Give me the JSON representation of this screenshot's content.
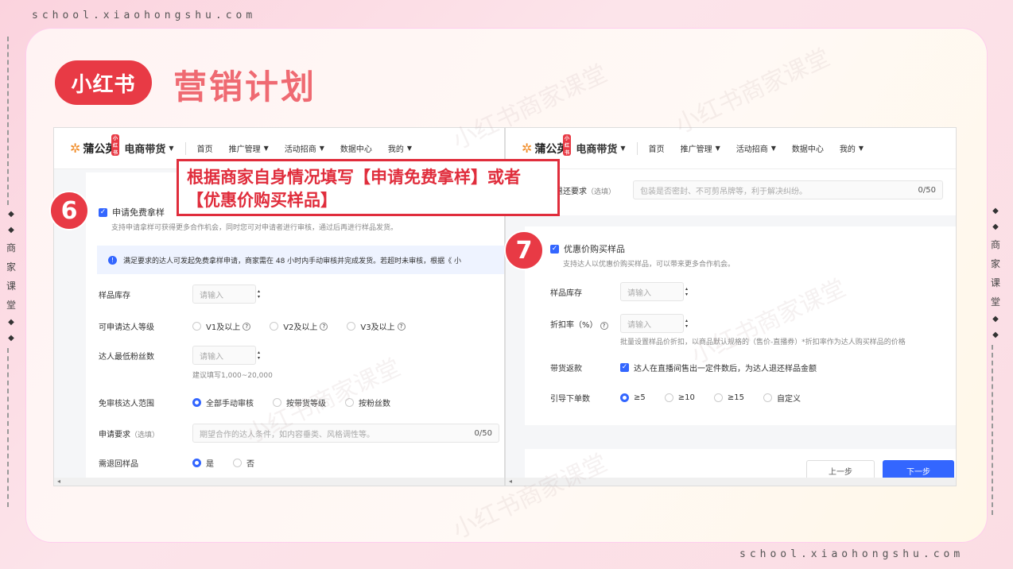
{
  "site_url": "school.xiaohongshu.com",
  "logo_text": "小红书",
  "page_title": "营销计划",
  "watermark": "小红书商家课堂",
  "side_label": [
    "商",
    "家",
    "课",
    "堂"
  ],
  "callout": "根据商家自身情况填写【申请免费拿样】或者【优惠价购买样品】",
  "nav": {
    "brand": "蒲公英",
    "brand_tag": "小红书",
    "section": "电商带货",
    "items": [
      "首页",
      "推广管理",
      "活动招商",
      "数据中心",
      "我的"
    ]
  },
  "left": {
    "step": "6",
    "checkbox_label": "申请免费拿样",
    "desc": "支持申请拿样可获得更多合作机会，同时您可对申请者进行审核，通过后再进行样品发货。",
    "info": "满足要求的达人可发起免费拿样申请，商家需在 48 小时内手动审核并完成发货。若超时未审核，根据《 小",
    "stock_label": "样品库存",
    "placeholder": "请输入",
    "level_label": "可申请达人等级",
    "levels": [
      "V1及以上",
      "V2及以上",
      "V3及以上"
    ],
    "fans_label": "达人最低粉丝数",
    "fans_hint": "建议填写1,000~20,000",
    "exempt_label": "免审核达人范围",
    "exempt_options": [
      "全部手动审核",
      "按带货等级",
      "按粉丝数"
    ],
    "req_label": "申请要求",
    "req_optional": "（选填）",
    "req_placeholder": "期望合作的达人条件，如内容垂类、风格调性等。",
    "req_count": "0/50",
    "return_label": "需退回样品",
    "return_options": [
      "是",
      "否"
    ]
  },
  "right": {
    "step": "7",
    "return_req_label": "拿样退还要求",
    "return_req_optional": "（选填）",
    "return_req_placeholder": "包装是否密封、不可剪吊牌等，利于解决纠纷。",
    "return_req_count": "0/50",
    "checkbox_label": "优惠价购买样品",
    "desc": "支持达人以优惠价购买样品，可以带来更多合作机会。",
    "stock_label": "样品库存",
    "placeholder": "请输入",
    "discount_label": "折扣率（%）",
    "discount_hint": "批量设置样品价折扣，以商品默认规格的（售价-直播券）*折扣率作为达人购买样品的价格",
    "rebate_label": "带货返款",
    "rebate_text": "达人在直播间售出一定件数后，为达人退还样品金额",
    "orders_label": "引导下单数",
    "orders_options": [
      "≥5",
      "≥10",
      "≥15",
      "自定义"
    ],
    "prev_button": "上一步",
    "next_button": "下一步"
  },
  "colors": {
    "accent": "#e83a45",
    "blue": "#3366ff",
    "title": "#ef6a72"
  }
}
